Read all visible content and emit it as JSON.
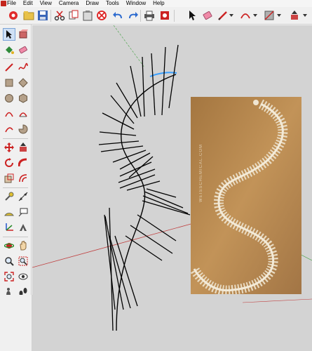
{
  "menubar": {
    "items": [
      "File",
      "Edit",
      "View",
      "Camera",
      "Draw",
      "Tools",
      "Window",
      "Help"
    ]
  },
  "toolbar": {
    "buttons": [
      "new-model-icon",
      "open-icon",
      "save-icon",
      "cut-icon",
      "copy-icon",
      "paste-icon",
      "erase-icon",
      "undo-icon",
      "redo-icon",
      "print-icon",
      "model-info-icon",
      "select-icon",
      "eraser-icon",
      "pencil-line-icon",
      "arc-icon",
      "rectangle-icon",
      "push-pull-icon"
    ]
  },
  "left_tools": {
    "buttons": [
      "select-icon",
      "make-component-icon",
      "paint-bucket-icon",
      "eraser-icon",
      "line-icon",
      "freehand-icon",
      "rectangle-icon",
      "rotated-rectangle-icon",
      "circle-icon",
      "polygon-icon",
      "arc-icon",
      "two-point-arc-icon",
      "three-point-arc-icon",
      "pie-icon",
      "move-icon",
      "push-pull-icon",
      "rotate-icon",
      "follow-me-icon",
      "scale-icon",
      "offset-icon",
      "tape-measure-icon",
      "dimension-icon",
      "protractor-icon",
      "text-icon",
      "axes-icon",
      "3d-text-icon",
      "orbit-icon",
      "pan-icon",
      "zoom-icon",
      "zoom-window-icon",
      "zoom-extents-icon",
      "previous-view-icon",
      "position-camera-icon",
      "look-around-icon",
      "walk-icon",
      "section-plane-icon"
    ]
  },
  "viewport": {
    "background": "#d3d3d3",
    "axis_red": "#c04040",
    "axis_green": "#40a040",
    "selection_blue": "#3aa0ff"
  },
  "photo": {
    "watermark": "WEISSCHEMICAL.COM",
    "bg": "#b68a4e"
  }
}
